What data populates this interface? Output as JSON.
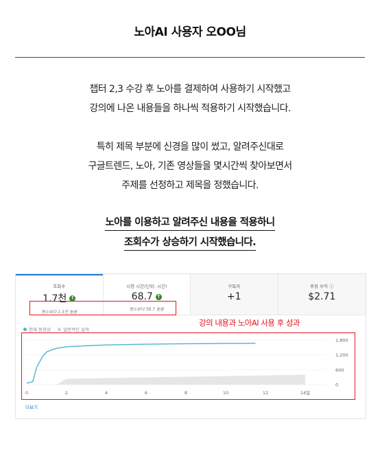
{
  "title": "노아AI 사용자 오OO님",
  "para1": [
    "챕터 2,3 수강 후 노아를 결제하여 사용하기 시작했고",
    "강의에 나온 내용들을 하나씩 적용하기 시작했습니다."
  ],
  "para2": [
    "특히 제목 부분에 신경을 많이 썼고, 알려주신대로",
    "구글트렌드, 노아, 기존 영상들을 몇시간씩 찾아보면서",
    "주제를 선정하고 제목을 정했습니다."
  ],
  "para3": [
    "노아를 이용하고 알려주신 내용을 적용하니",
    "조회수가 상승하기 시작했습니다."
  ],
  "metrics": [
    {
      "label": "조회수",
      "value": "1.7천",
      "sub": "평소보다 1.3천 높음"
    },
    {
      "label": "시청 시간(단위: 시간)",
      "value": "68.7",
      "sub": "평소보다 58.7 높음"
    },
    {
      "label": "구독자",
      "value": "+1",
      "sub": ""
    },
    {
      "label": "추정 수익",
      "value": "$2.71",
      "sub": ""
    }
  ],
  "legend": {
    "current": "현재 동영상",
    "typical": "일반적인 실적"
  },
  "caption": "강의 내용과 노아AI 사용 후 성과",
  "more_link": "더보기",
  "colors": {
    "accent": "#1f7ad0",
    "highlight": "#e0141e",
    "line": "#4fb3cf",
    "band": "#e6e6e6",
    "up": "#2e8b2e"
  },
  "chart_data": {
    "type": "line",
    "x_ticks": [
      "0",
      "2",
      "4",
      "6",
      "8",
      "10",
      "12",
      "14일"
    ],
    "y_ticks": [
      "1,800",
      "1,200",
      "600",
      "0"
    ],
    "xlim": [
      0,
      14
    ],
    "ylim": [
      0,
      1800
    ],
    "series": [
      {
        "name": "현재 동영상",
        "x": [
          0,
          0.3,
          0.5,
          0.8,
          1.0,
          1.3,
          1.6,
          2,
          3,
          4,
          6,
          8,
          10,
          11.5
        ],
        "y": [
          60,
          120,
          700,
          1150,
          1320,
          1420,
          1480,
          1530,
          1570,
          1600,
          1630,
          1650,
          1665,
          1670
        ]
      },
      {
        "name": "일반적인 실적",
        "x": [
          0,
          1.5,
          2,
          14
        ],
        "y_low": [
          0,
          0,
          0,
          0
        ],
        "y_high": [
          0,
          0,
          240,
          400
        ]
      }
    ]
  }
}
